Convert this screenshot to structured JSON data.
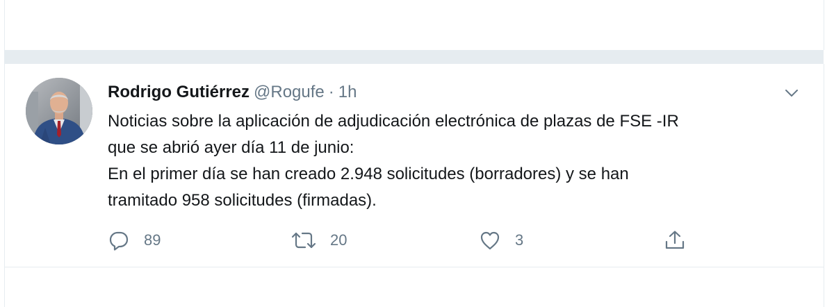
{
  "tweet": {
    "author_name": "Rodrigo Gutiérrez",
    "handle": "@Rogufe",
    "separator": "·",
    "time": "1h",
    "text_lines": [
      "Noticias sobre la aplicación de adjudicación electrónica de plazas de FSE -IR",
      "que se abrió ayer día 11 de junio:",
      "En el primer día se han creado 2.948 solicitudes (borradores) y se han",
      "tramitado 958 solicitudes (firmadas)."
    ],
    "actions": {
      "reply": {
        "icon": "reply-icon",
        "count": "89"
      },
      "retweet": {
        "icon": "retweet-icon",
        "count": "20"
      },
      "like": {
        "icon": "heart-icon",
        "count": "3"
      },
      "share": {
        "icon": "share-icon"
      }
    },
    "menu_icon": "chevron-down-icon"
  },
  "colors": {
    "text_primary": "#14171a",
    "text_secondary": "#657786",
    "separator_gray": "#e6ecf0"
  }
}
